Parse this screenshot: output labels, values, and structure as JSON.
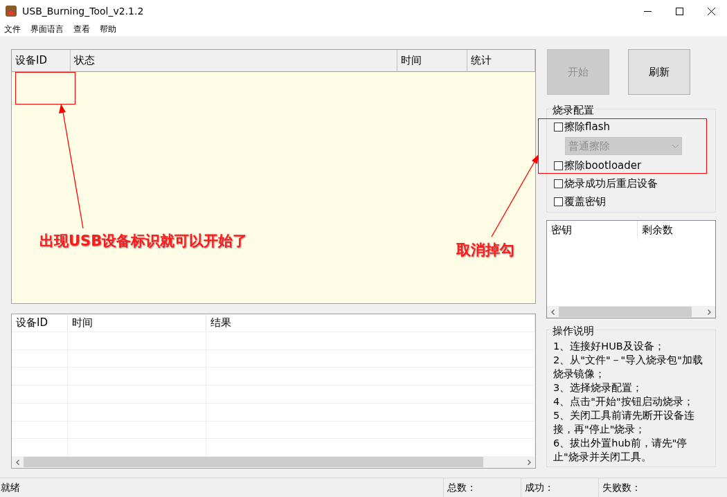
{
  "window": {
    "title": "USB_Burning_Tool_v2.1.2"
  },
  "menu": [
    "文件",
    "界面语言",
    "查看",
    "帮助"
  ],
  "device_table": {
    "columns": [
      "设备ID",
      "状态",
      "时间",
      "统计"
    ]
  },
  "buttons": [
    {
      "label": "开始",
      "disabled": true
    },
    {
      "label": "刷新",
      "disabled": false
    }
  ],
  "burn_config": {
    "title": "烧录配置",
    "options": [
      {
        "kind": "checkbox",
        "label": "擦除flash",
        "checked": false
      },
      {
        "kind": "dropdown",
        "value": "普通擦除",
        "disabled": true
      },
      {
        "kind": "checkbox",
        "label": "擦除bootloader",
        "checked": false
      },
      {
        "kind": "checkbox",
        "label": "烧录成功后重启设备",
        "checked": false
      },
      {
        "kind": "checkbox",
        "label": "覆盖密钥",
        "checked": false
      }
    ]
  },
  "key_table": {
    "columns": [
      "密钥",
      "剩余数"
    ]
  },
  "result_table": {
    "columns": [
      "设备ID",
      "时间",
      "结果"
    ]
  },
  "instructions": {
    "title": "操作说明",
    "lines": [
      "1、连接好HUB及设备；",
      "2、从\"文件\"－\"导入烧录包\"加载烧录镜像；",
      "3、选择烧录配置；",
      "4、点击\"开始\"按钮启动烧录；",
      "5、关闭工具前请先断开设备连接，再\"停止\"烧录；",
      "6、拔出外置hub前，请先\"停止\"烧录并关闭工具。"
    ]
  },
  "status_bar": [
    "就绪",
    "总数：",
    "成功：",
    "失败数："
  ],
  "annotations": [
    {
      "text": "出现USB设备标识就可以开始了"
    },
    {
      "text": "取消掉勾"
    }
  ]
}
